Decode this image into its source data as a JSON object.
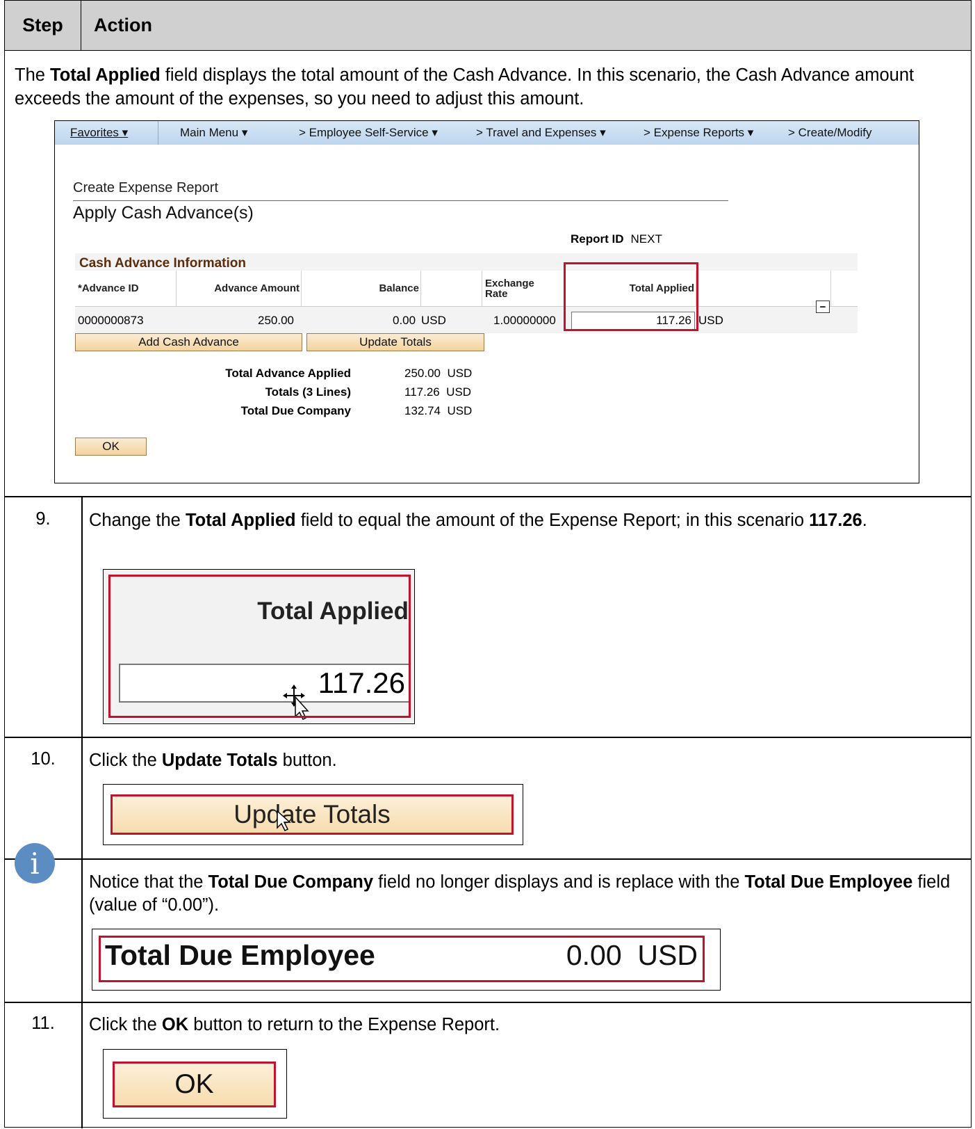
{
  "header": {
    "step": "Step",
    "action": "Action"
  },
  "intro": {
    "p1": "The ",
    "bold": "Total Applied",
    "p2": " field displays the total amount of the Cash Advance.  In this scenario, the Cash Advance amount exceeds the amount of the expenses, so you need to adjust this amount."
  },
  "screenshot": {
    "nav": {
      "favorites": "Favorites ▾",
      "main_menu": "Main Menu ▾",
      "employee_self_service": "> Employee Self-Service ▾",
      "travel_and_expenses": "> Travel and Expenses ▾",
      "expense_reports": "> Expense Reports ▾",
      "create_modify": "> Create/Modify"
    },
    "section_title": "Create Expense Report",
    "page_title": "Apply Cash Advance(s)",
    "report_id_label": "Report ID",
    "report_id_value": "NEXT",
    "grid": {
      "title": "Cash Advance Information",
      "headers": {
        "advance_id": "*Advance ID",
        "advance_amount": "Advance Amount",
        "balance": "Balance",
        "exchange_rate": "Exchange Rate",
        "total_applied": "Total Applied"
      },
      "row": {
        "advance_id": "0000000873",
        "advance_amount": "250.00",
        "balance": "0.00",
        "balance_currency": "USD",
        "exchange_rate": "1.00000000",
        "total_applied": "117.26",
        "total_applied_currency": "USD"
      }
    },
    "buttons": {
      "add_cash_advance": "Add Cash Advance",
      "update_totals": "Update Totals",
      "ok": "OK"
    },
    "totals": {
      "total_advance_applied_label": "Total Advance Applied",
      "total_advance_applied_value": "250.00  USD",
      "totals_lines_label": "Totals (3 Lines)",
      "totals_lines_value": "117.26  USD",
      "total_due_company_label": "Total Due Company",
      "total_due_company_value": "132.74  USD"
    }
  },
  "steps": [
    {
      "number": "9.",
      "t1": "Change the ",
      "b1": "Total Applied",
      "t2": " field to equal the amount of the Expense Report; in this scenario ",
      "b2": "117.26",
      "t3": ".",
      "zoom_label": "Total Applied",
      "zoom_value": "117.26"
    },
    {
      "number": "10.",
      "t1": "Click the ",
      "b1": "Update Totals",
      "t2": " button.",
      "zoom_label": "Update Totals"
    },
    {
      "t1": "Notice that the ",
      "b1": "Total Due Company",
      "t2": " field no longer displays and is replace with the ",
      "b2": "Total Due Employee",
      "t3": " field (value of “0.00”).",
      "zoom_label": "Total Due Employee",
      "zoom_value": "0.00  USD"
    },
    {
      "number": "11.",
      "t1": "Click the ",
      "b1": "OK",
      "t2": " button to return to the Expense Report.",
      "zoom_label": "OK"
    }
  ],
  "colors": {
    "highlight": "#c0142c",
    "header_bg": "#d0d0d0",
    "button": "#f4d49d",
    "info": "#5b8cc2"
  }
}
